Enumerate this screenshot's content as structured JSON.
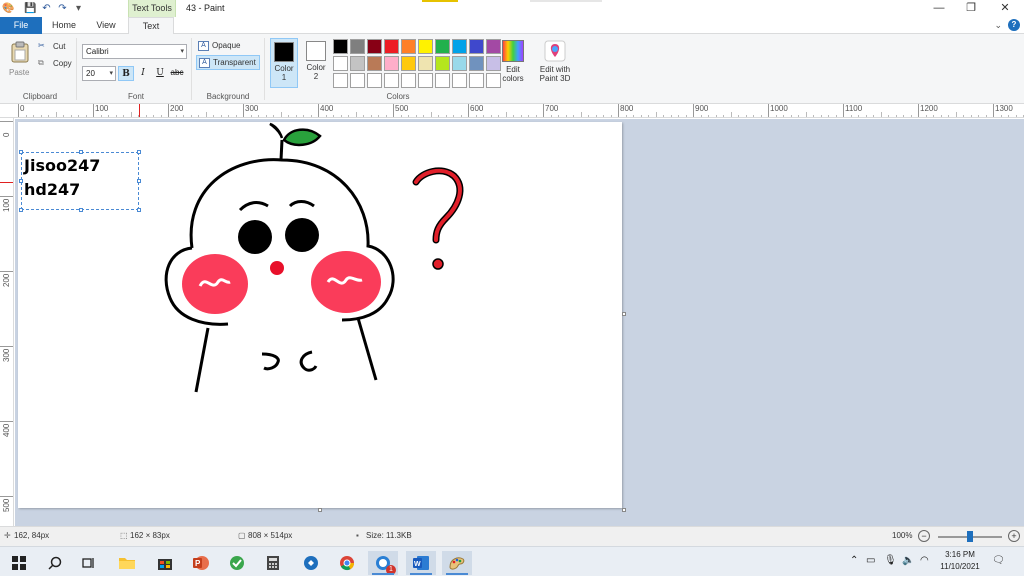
{
  "window": {
    "title": "43 - Paint",
    "context_tab": "Text Tools",
    "min_glyph": "—",
    "max_glyph": "❐",
    "close_glyph": "✕"
  },
  "tabs": {
    "file": "File",
    "home": "Home",
    "view": "View",
    "text": "Text",
    "help": "?"
  },
  "clipboard": {
    "paste": "Paste",
    "cut": "Cut",
    "copy": "Copy",
    "label": "Clipboard"
  },
  "font": {
    "family": "Calibri",
    "size": "20",
    "bold": "B",
    "italic": "I",
    "underline": "U",
    "strike": "abc",
    "label": "Font"
  },
  "background": {
    "opaque": "Opaque",
    "transparent": "Transparent",
    "label": "Background"
  },
  "colors": {
    "color1_label": "Color 1",
    "color2_label": "Color 2",
    "color1_num": "1",
    "color2_num": "2",
    "color1_word": "Color",
    "color2_word": "Color",
    "color1_value": "#000000",
    "color2_value": "#ffffff",
    "edit_colors_1": "Edit",
    "edit_colors_2": "colors",
    "edit_paint3d_1": "Edit with",
    "edit_paint3d_2": "Paint 3D",
    "label": "Colors",
    "palette": [
      "#000000",
      "#7f7f7f",
      "#880015",
      "#ed1c24",
      "#ff7f27",
      "#fff200",
      "#22b14c",
      "#00a2e8",
      "#3f48cc",
      "#a349a4",
      "#ffffff",
      "#c3c3c3",
      "#b97a57",
      "#ffaec9",
      "#ffc90e",
      "#efe4b0",
      "#b5e61d",
      "#99d9ea",
      "#7092be",
      "#c8bfe7",
      "#ffffff",
      "#ffffff",
      "#ffffff",
      "#ffffff",
      "#ffffff",
      "#ffffff",
      "#ffffff",
      "#ffffff",
      "#ffffff",
      "#ffffff"
    ]
  },
  "ruler": {
    "h_ticks": [
      "0",
      "100",
      "200",
      "300",
      "400",
      "500",
      "600",
      "700",
      "800",
      "900",
      "1000",
      "1100",
      "1200",
      "1300"
    ],
    "v_ticks": [
      "0",
      "100",
      "200",
      "300",
      "400",
      "500"
    ]
  },
  "canvas": {
    "text_line1": "Jisoo247",
    "text_line2": "hd247"
  },
  "status": {
    "cursor_pos": "162, 84px",
    "selection_size": "162 × 83px",
    "image_size": "808 × 514px",
    "file_size": "Size: 11.3KB",
    "zoom": "100%",
    "zoom_fraction": 0.5
  },
  "taskbar": {
    "time": "3:16 PM",
    "date": "11/10/2021",
    "badge": "1"
  }
}
